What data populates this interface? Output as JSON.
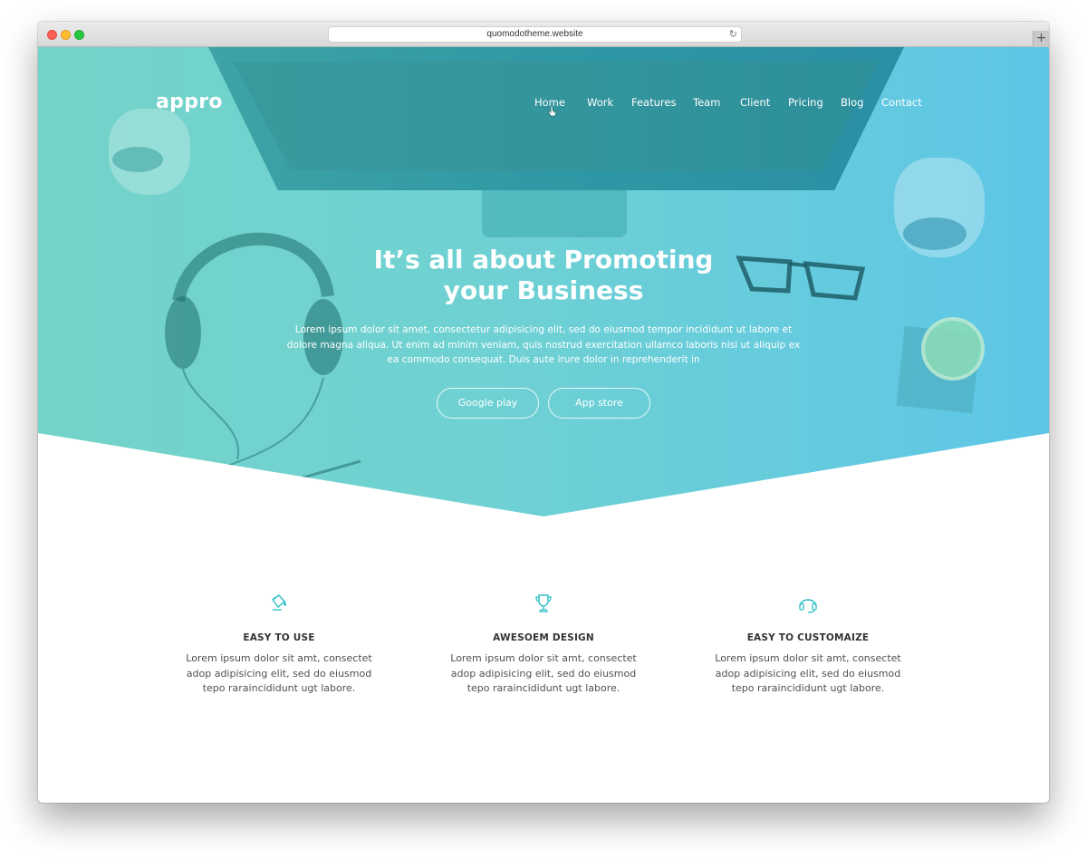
{
  "browser": {
    "url": "quomodotheme.website",
    "reload_icon": "reload-icon",
    "new_tab_icon": "plus-icon"
  },
  "nav": {
    "logo": "appro",
    "items": [
      {
        "label": "Home"
      },
      {
        "label": "Work"
      },
      {
        "label": "Features"
      },
      {
        "label": "Team"
      },
      {
        "label": "Client"
      },
      {
        "label": "Pricing"
      },
      {
        "label": "Blog"
      },
      {
        "label": "Contact"
      }
    ]
  },
  "hero": {
    "title_line1": "It’s all about Promoting",
    "title_line2": "your Business",
    "text_line1": "Lorem ipsum dolor sit amet, consectetur adipisicing elit, sed do eiusmod tempor incididunt ut labore et",
    "text_line2": "dolore magna aliqua. Ut enim ad minim veniam, quis nostrud exercitation ullamco laboris nisi ut aliquip ex",
    "text_line3": "ea commodo consequat. Duis aute irure dolor in reprehenderit in",
    "button_google": "Google play",
    "button_appstore": "App store"
  },
  "features": [
    {
      "icon": "paint-bucket-icon",
      "title": "EASY TO USE",
      "line1": "Lorem ipsum dolor sit amt, consectet",
      "line2": "adop adipisicing elit, sed do eiusmod",
      "line3": "tepo raraincididunt ugt labore."
    },
    {
      "icon": "trophy-icon",
      "title": "AWESOEM DESIGN",
      "line1": "Lorem ipsum dolor sit amt, consectet",
      "line2": "adop adipisicing elit, sed do eiusmod",
      "line3": "tepo raraincididunt ugt labore."
    },
    {
      "icon": "headset-icon",
      "title": "EASY TO CUSTOMAIZE",
      "line1": "Lorem ipsum dolor sit amt, consectet",
      "line2": "adop adipisicing elit, sed do eiusmod",
      "line3": "tepo raraincididunt ugt labore."
    }
  ],
  "colors": {
    "hero_start": "#74d3c8",
    "hero_end": "#5dc6e6",
    "icon_accent": "#2bbfc6",
    "heading_text": "#333333"
  }
}
